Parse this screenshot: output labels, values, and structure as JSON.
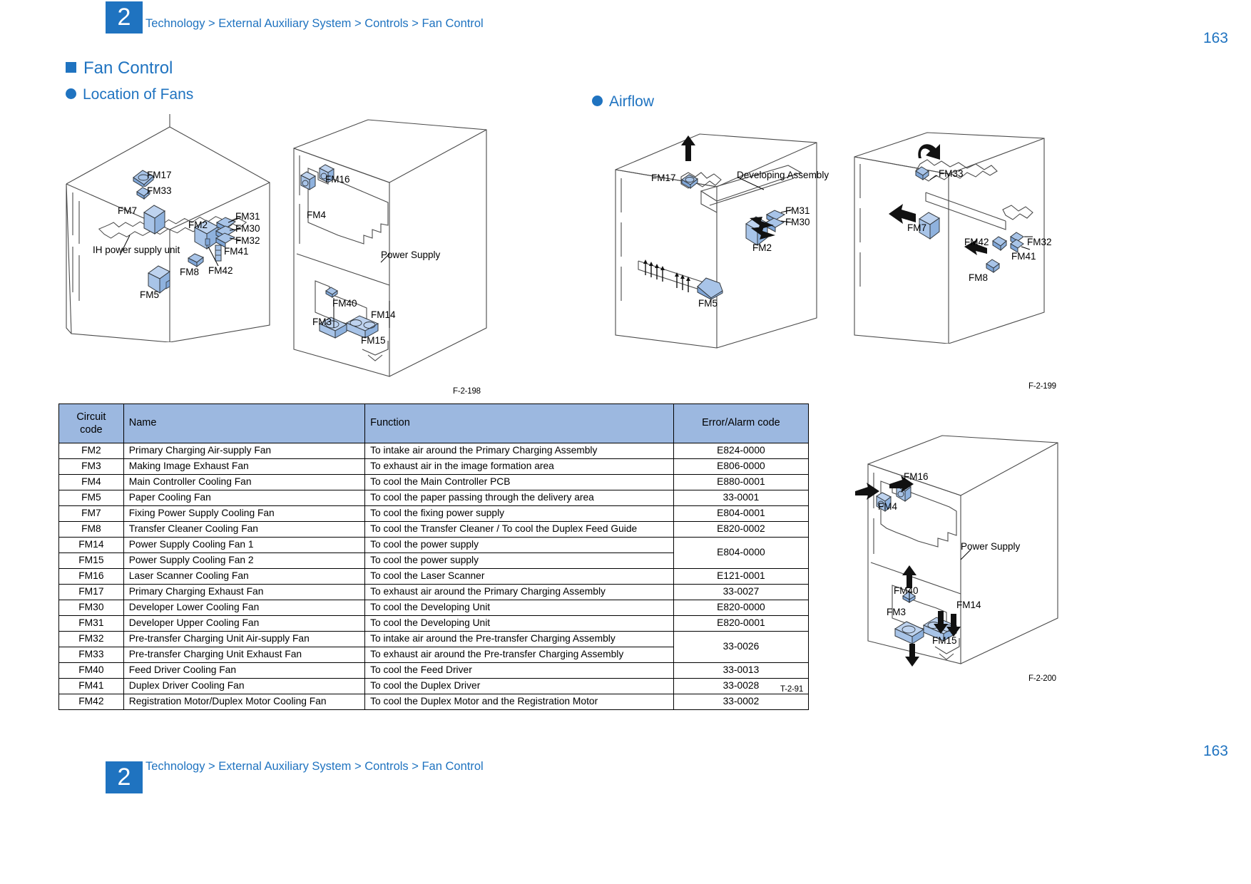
{
  "header": {
    "chapter": "2",
    "breadcrumb": "Technology > External Auxiliary System > Controls > Fan Control",
    "page_number": "163"
  },
  "footer": {
    "chapter": "2",
    "breadcrumb": "Technology > External Auxiliary System > Controls > Fan Control",
    "page_number": "163"
  },
  "sections": {
    "title": "Fan Control",
    "location_of_fans": "Location of Fans",
    "airflow": "Airflow"
  },
  "colors": {
    "accent": "#1f73c0",
    "table_header_bg": "#9cb8e0",
    "fan_fill": "#a8c4e8",
    "fan_fill_dark": "#7fa6d8"
  },
  "figures": {
    "f198_caption": "F-2-198",
    "f199_caption": "F-2-199",
    "f200_caption": "F-2-200",
    "table_caption": "T-2-91"
  },
  "diagram_location_left": {
    "labels": [
      "FM17",
      "FM33",
      "FM7",
      "IH power supply unit",
      "FM2",
      "FM31",
      "FM30",
      "FM32",
      "FM41",
      "FM8",
      "FM42",
      "FM5"
    ]
  },
  "diagram_location_right": {
    "labels": [
      "FM16",
      "FM4",
      "Power Supply",
      "FM40",
      "FM3",
      "FM14",
      "FM15"
    ]
  },
  "diagram_airflow_left": {
    "labels": [
      "FM17",
      "Developing Assembly",
      "FM31",
      "FM30",
      "FM2",
      "FM5"
    ]
  },
  "diagram_airflow_right": {
    "labels": [
      "FM33",
      "FM7",
      "FM42",
      "FM32",
      "FM41",
      "FM8"
    ]
  },
  "diagram_airflow_bottom": {
    "labels": [
      "FM16",
      "FM4",
      "Power Supply",
      "FM40",
      "FM3",
      "FM14",
      "FM15"
    ]
  },
  "table": {
    "columns": [
      "Circuit code",
      "Name",
      "Function",
      "Error/Alarm code"
    ],
    "header_circuit_line1": "Circuit",
    "header_circuit_line2": "code",
    "header_name": "Name",
    "header_function": "Function",
    "header_error": "Error/Alarm code",
    "rows": [
      {
        "code": "FM2",
        "name": "Primary Charging Air-supply Fan",
        "function": "To intake air around the Primary Charging Assembly",
        "error": "E824-0000"
      },
      {
        "code": "FM3",
        "name": "Making Image Exhaust Fan",
        "function": "To exhaust air in the image formation area",
        "error": "E806-0000"
      },
      {
        "code": "FM4",
        "name": "Main Controller Cooling Fan",
        "function": "To cool the Main Controller PCB",
        "error": "E880-0001"
      },
      {
        "code": "FM5",
        "name": "Paper Cooling Fan",
        "function": "To cool the paper passing through the delivery area",
        "error": "33-0001"
      },
      {
        "code": "FM7",
        "name": "Fixing Power Supply Cooling Fan",
        "function": "To cool the fixing power supply",
        "error": "E804-0001"
      },
      {
        "code": "FM8",
        "name": "Transfer Cleaner Cooling Fan",
        "function": "To cool the Transfer Cleaner / To cool the  Duplex Feed Guide",
        "error": "E820-0002"
      },
      {
        "code": "FM14",
        "name": "Power Supply Cooling Fan 1",
        "function": "To cool the power supply",
        "error": "E804-0000",
        "error_rowspan": 2
      },
      {
        "code": "FM15",
        "name": "Power Supply Cooling Fan 2",
        "function": "To cool the power supply",
        "error": null
      },
      {
        "code": "FM16",
        "name": "Laser Scanner Cooling Fan",
        "function": "To cool the Laser Scanner",
        "error": "E121-0001"
      },
      {
        "code": "FM17",
        "name": "Primary Charging Exhaust Fan",
        "function": "To exhaust air around the Primary Charging Assembly",
        "error": "33-0027"
      },
      {
        "code": "FM30",
        "name": "Developer Lower Cooling Fan",
        "function": "To cool the Developing Unit",
        "error": "E820-0000"
      },
      {
        "code": "FM31",
        "name": "Developer Upper Cooling Fan",
        "function": "To cool the Developing Unit",
        "error": "E820-0001"
      },
      {
        "code": "FM32",
        "name": "Pre-transfer Charging Unit Air-supply Fan",
        "function": "To intake air around the Pre-transfer Charging Assembly",
        "error": "33-0026",
        "error_rowspan": 2
      },
      {
        "code": "FM33",
        "name": "Pre-transfer Charging Unit Exhaust Fan",
        "function": "To exhaust air around the Pre-transfer Charging Assembly",
        "error": null
      },
      {
        "code": "FM40",
        "name": "Feed Driver Cooling Fan",
        "function": "To cool the Feed Driver",
        "error": "33-0013"
      },
      {
        "code": "FM41",
        "name": "Duplex Driver Cooling Fan",
        "function": "To cool the Duplex Driver",
        "error": "33-0028"
      },
      {
        "code": "FM42",
        "name": "Registration Motor/Duplex Motor Cooling Fan",
        "function": "To cool the Duplex Motor and the Registration Motor",
        "error": "33-0002"
      }
    ]
  }
}
